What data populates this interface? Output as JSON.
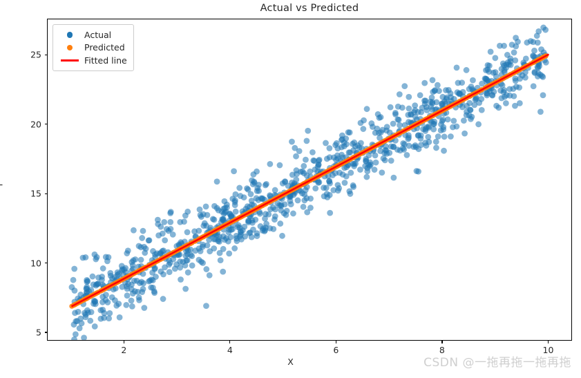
{
  "chart_data": {
    "type": "scatter",
    "title": "Actual vs Predicted",
    "xlabel": "X",
    "ylabel": "Y",
    "xlim": [
      0.55,
      10.45
    ],
    "ylim": [
      4.4,
      27.6
    ],
    "xticks": [
      2,
      4,
      6,
      8,
      10
    ],
    "yticks": [
      5,
      10,
      15,
      20,
      25
    ],
    "grid": false,
    "legend_position": "upper left",
    "n_points": 1000,
    "model": {
      "slope": 2.02,
      "intercept": 4.9,
      "noise_sigma": 1.3,
      "x_min": 1.0,
      "x_max": 10.0
    },
    "fitted_line": {
      "x": [
        1.0,
        10.0
      ],
      "y": [
        6.92,
        25.08
      ]
    },
    "series": [
      {
        "name": "Actual",
        "marker": "circle",
        "color": "#1f77b4",
        "alpha": 0.55,
        "size": 9
      },
      {
        "name": "Predicted",
        "marker": "circle",
        "color": "#ff7f0e",
        "alpha": 0.9,
        "size": 7
      },
      {
        "name": "Fitted line",
        "marker": "line",
        "color": "#ff0000",
        "alpha": 1.0,
        "linewidth": 2.6
      }
    ]
  },
  "legend": {
    "items": [
      {
        "label": "Actual",
        "marker": "circle",
        "color": "#1f77b4"
      },
      {
        "label": "Predicted",
        "marker": "circle",
        "color": "#ff7f0e"
      },
      {
        "label": "Fitted line",
        "marker": "line",
        "color": "#ff0000"
      }
    ]
  },
  "axes": {
    "xticks": [
      "2",
      "4",
      "6",
      "8",
      "10"
    ],
    "yticks": [
      "25",
      "20",
      "15",
      "10",
      "5"
    ],
    "xlabel": "X",
    "ylabel": "Y"
  },
  "watermark": {
    "text": "CSDN @一拖再拖一拖再拖"
  }
}
